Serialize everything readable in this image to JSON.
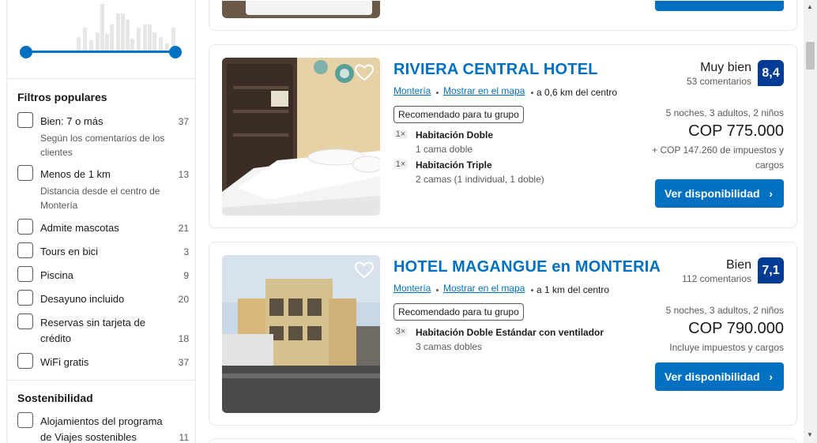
{
  "sidebar": {
    "popular_title": "Filtros populares",
    "sustainability_title": "Sostenibilidad",
    "filters": [
      {
        "label": "Bien: 7 o más",
        "sub": "Según los comentarios de los clientes",
        "count": "37"
      },
      {
        "label": "Menos de 1 km",
        "sub": "Distancia desde el centro de Montería",
        "count": "13"
      },
      {
        "label": "Admite mascotas",
        "count": "21"
      },
      {
        "label": "Tours en bici",
        "count": "3"
      },
      {
        "label": "Piscina",
        "count": "9"
      },
      {
        "label": "Desayuno incluido",
        "count": "20"
      },
      {
        "label_line1": "Reservas sin tarjeta de",
        "label_line2": "crédito",
        "count": "18"
      },
      {
        "label": "WiFi gratis",
        "count": "37"
      }
    ],
    "sustain_filter": {
      "label_line1": "Alojamientos del programa",
      "label_line2": "de Viajes sostenibles",
      "count": "11"
    }
  },
  "hotels": [
    {
      "name": "RIVIERA CENTRAL HOTEL",
      "city": "Montería",
      "map_link": "Mostrar en el mapa",
      "distance": "a 0,6 km del centro",
      "tag": "Recomendado para tu grupo",
      "rooms": [
        {
          "qty": "1×",
          "name": "Habitación Doble",
          "beds": "1 cama doble"
        },
        {
          "qty": "1×",
          "name": "Habitación Triple",
          "beds": "2 camas (1 individual, 1 doble)"
        }
      ],
      "score_word": "Muy bien",
      "reviews": "53 comentarios",
      "score": "8,4",
      "stay": "5 noches, 3 adultos, 2 niños",
      "price": "COP 775.000",
      "taxes": "+ COP 147.260 de impuestos y cargos",
      "cta": "Ver disponibilidad"
    },
    {
      "name": "HOTEL MAGANGUE en MONTERIA",
      "city": "Montería",
      "map_link": "Mostrar en el mapa",
      "distance": "a 1 km del centro",
      "tag": "Recomendado para tu grupo",
      "rooms": [
        {
          "qty": "3×",
          "name": "Habitación Doble Estándar con ventilador",
          "beds": "3 camas dobles"
        }
      ],
      "score_word": "Bien",
      "reviews": "112 comentarios",
      "score": "7,1",
      "stay": "5 noches, 3 adultos, 2 niños",
      "price": "COP 790.000",
      "taxes": "Incluye impuestos y cargos",
      "cta": "Ver disponibilidad"
    }
  ],
  "colors": {
    "brand": "#0071c2",
    "score_bg": "#003b95"
  },
  "icons": [
    "heart-icon",
    "chevron-right-icon",
    "checkbox-icon"
  ]
}
